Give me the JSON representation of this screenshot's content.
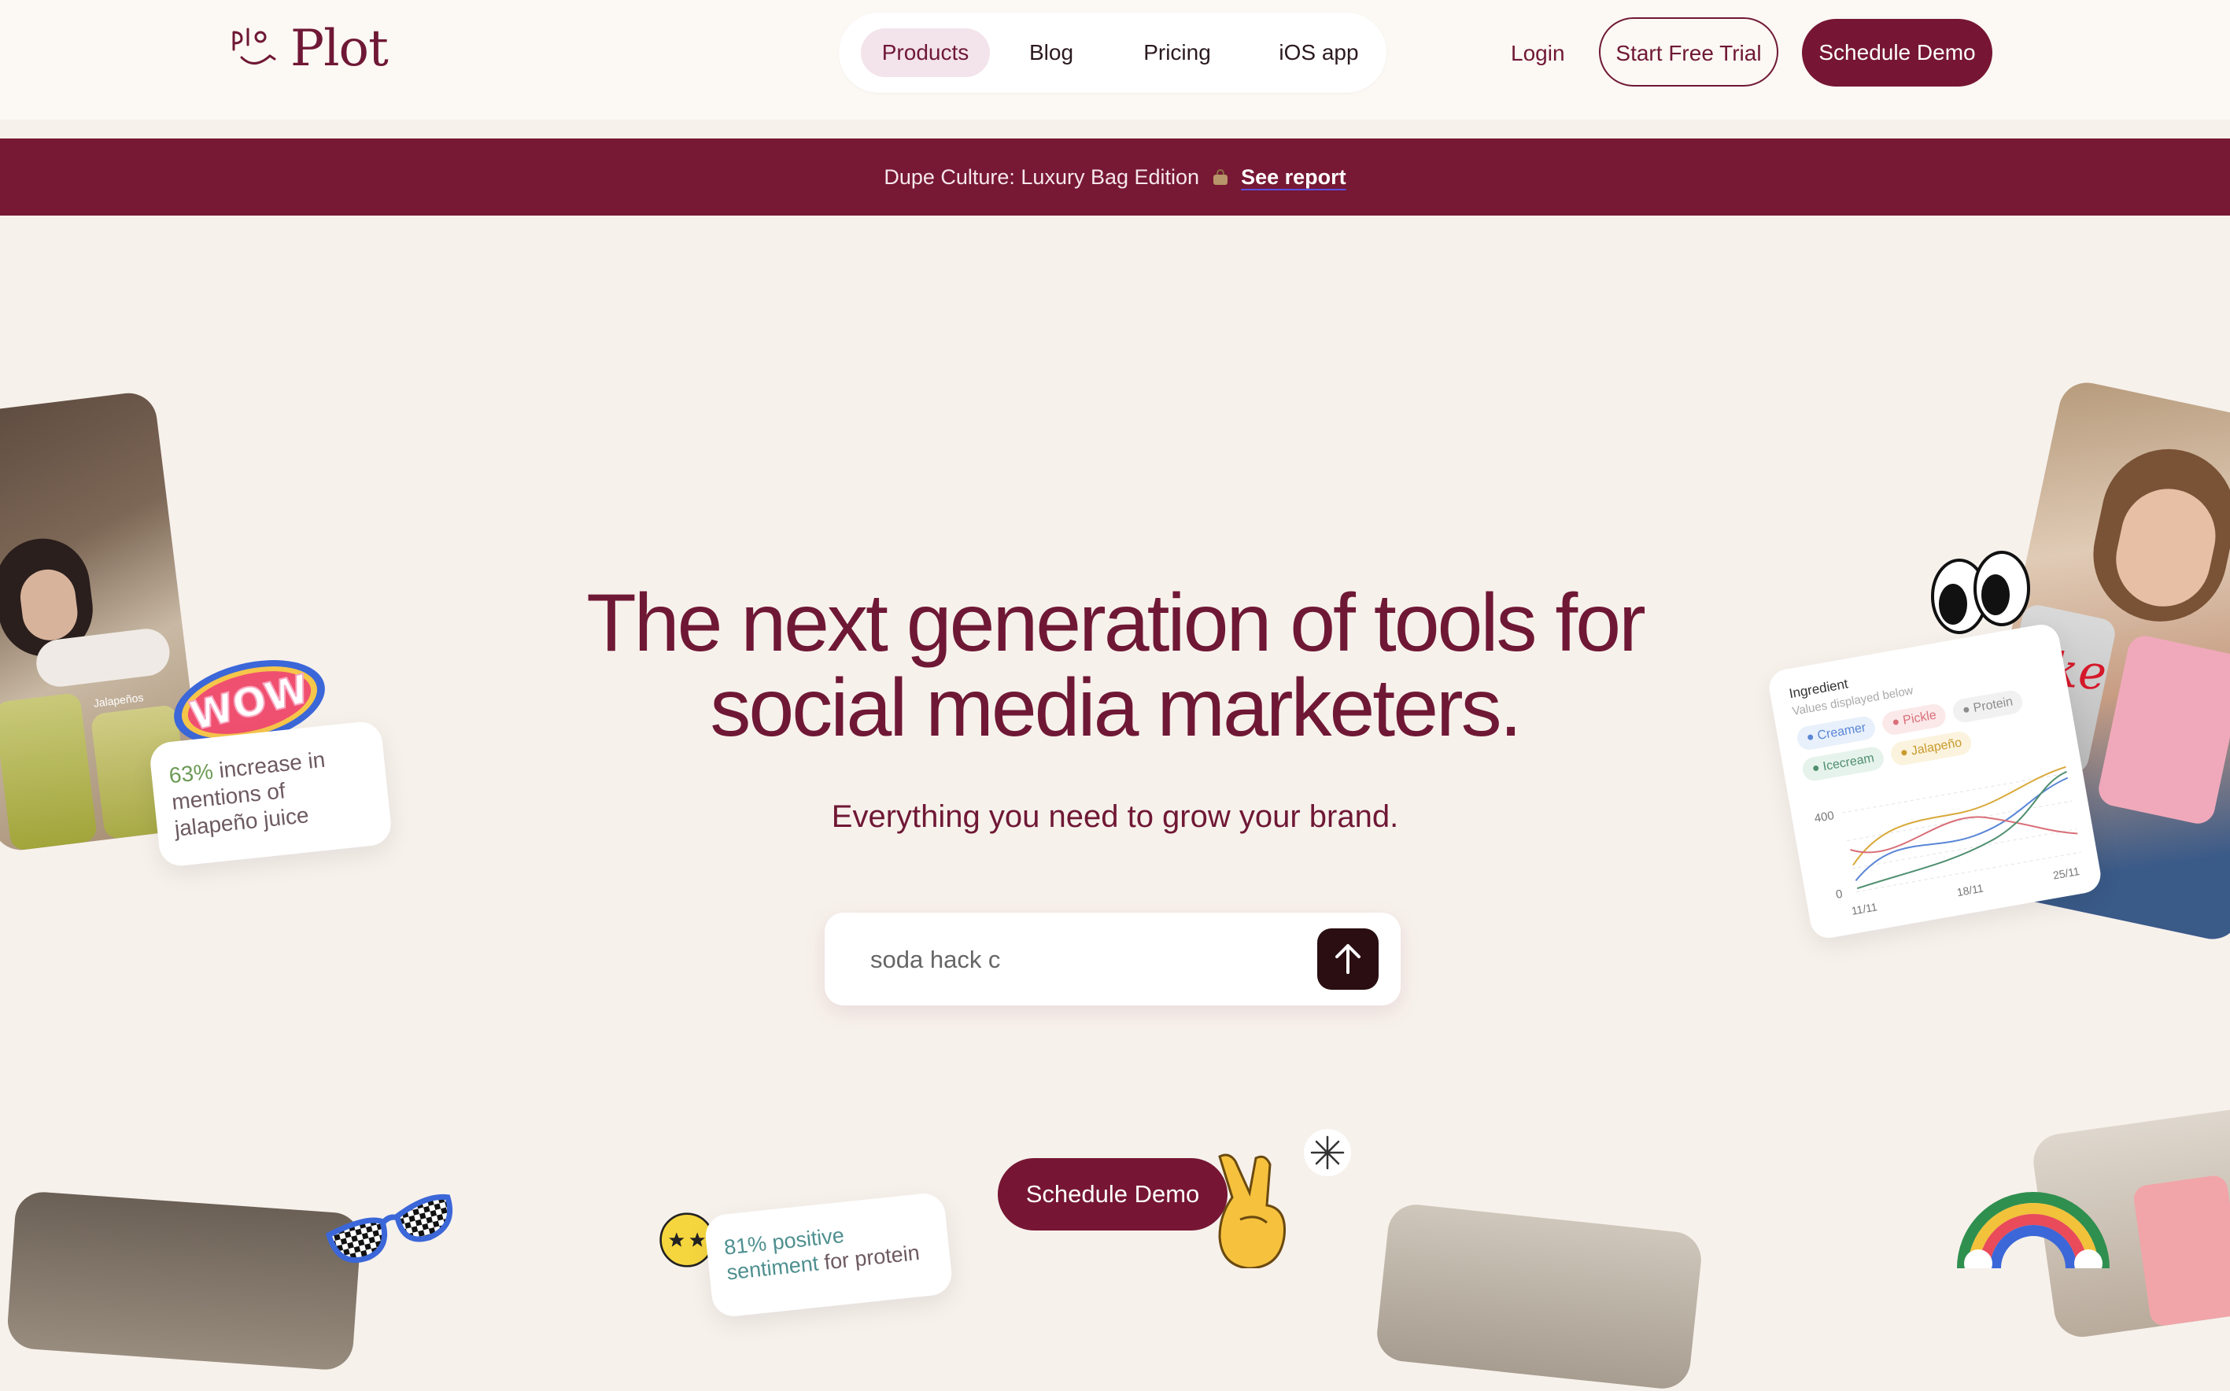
{
  "header": {
    "logo_text": "Plot",
    "nav": [
      "Products",
      "Blog",
      "Pricing",
      "iOS app"
    ],
    "login": "Login",
    "trial": "Start Free Trial",
    "demo": "Schedule Demo"
  },
  "banner": {
    "text": "Dupe Culture: Luxury Bag Edition",
    "link": "See report"
  },
  "hero": {
    "title_line1": "The next generation of tools for",
    "title_line2": "social media marketers.",
    "subtitle": "Everything you need to grow your brand.",
    "search_value": "soda hack c",
    "cta": "Schedule Demo"
  },
  "left_card": {
    "sticker": "WOW",
    "percent": "63%",
    "line1": " increase in",
    "line2": "mentions of",
    "line3": "jalapeño juice",
    "photo_label": "Jalapeños"
  },
  "bottom_card": {
    "percent": "81% positive",
    "line2_a": "sentiment",
    "line2_b": " for protein"
  },
  "chart_card": {
    "title": "Ingredient",
    "subtitle": "Values displayed below",
    "tags": [
      {
        "label": "Creamer",
        "color": "#5a86d6",
        "bg": "#e8f0fb"
      },
      {
        "label": "Pickle",
        "color": "#d96f78",
        "bg": "#fbe9ea"
      },
      {
        "label": "Protein",
        "color": "#8d8d8d",
        "bg": "#f1f1f1"
      },
      {
        "label": "Icecream",
        "color": "#4f8f6f",
        "bg": "#e6f3ec"
      },
      {
        "label": "Jalapeño",
        "color": "#c99a2e",
        "bg": "#fbf3dd"
      }
    ],
    "y_ticks": [
      "400",
      "0"
    ],
    "x_ticks": [
      "11/11",
      "18/11",
      "25/11"
    ]
  },
  "colors": {
    "brand": "#761634",
    "background": "#f7f1ec",
    "header": "#fcf8f4"
  }
}
